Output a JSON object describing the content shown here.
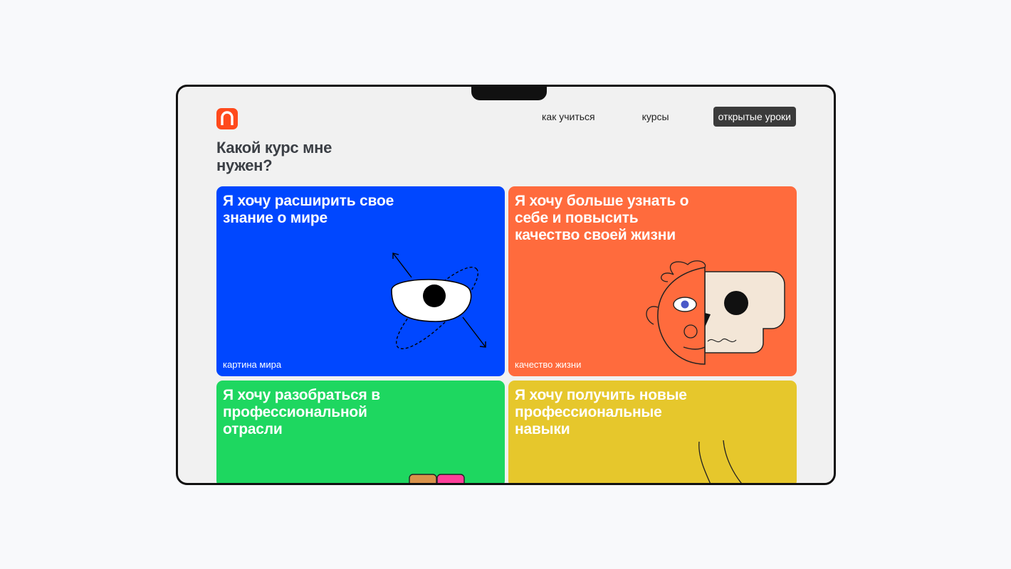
{
  "header": {
    "logo_icon": "arch-logo-icon",
    "nav": [
      {
        "label": "как учиться",
        "active": false
      },
      {
        "label": "курсы",
        "active": false
      },
      {
        "label": "открытые уроки",
        "active": true
      }
    ]
  },
  "main": {
    "title": "Какой курс мне нужен?",
    "cards": [
      {
        "heading": "Я хочу расширить свое знание о мире",
        "tag": "картина мира",
        "color": "#0047ff",
        "illustration": "eye-orbit-icon"
      },
      {
        "heading": "Я хочу больше узнать о себе и повысить качество своей жизни",
        "tag": "качество жизни",
        "color": "#ff6b3d",
        "illustration": "face-skull-icon"
      },
      {
        "heading": "Я хочу разобраться в профессиональной отрасли",
        "tag": "",
        "color": "#1ed760",
        "illustration": "blocks-icon"
      },
      {
        "heading": "Я хочу получить новые профессиональные навыки",
        "tag": "",
        "color": "#e6c72c",
        "illustration": "line-drawing-icon"
      }
    ]
  },
  "colors": {
    "accent": "#ff4a1c",
    "frame": "#111111",
    "background": "#f8f9fb",
    "screen": "#f1f1f1"
  }
}
